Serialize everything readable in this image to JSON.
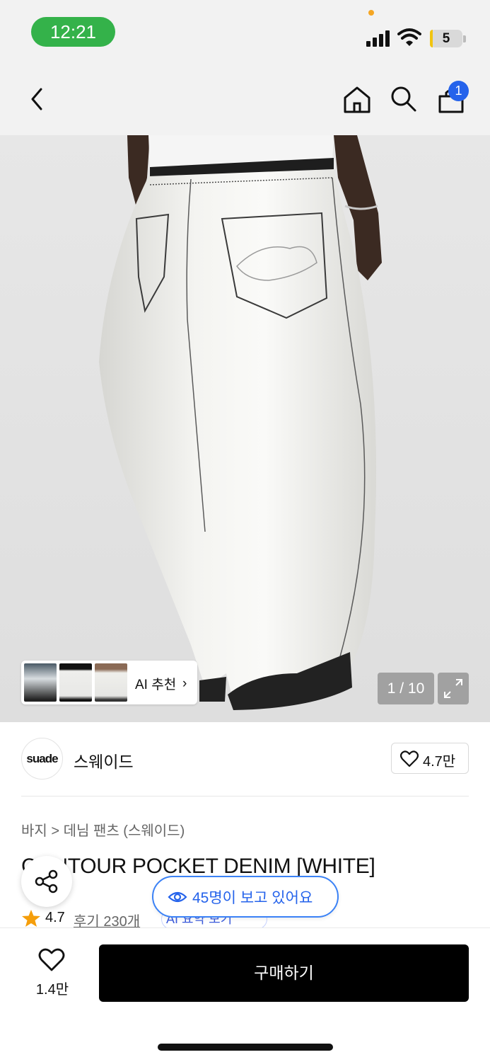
{
  "status_bar": {
    "time": "12:21",
    "battery": "5",
    "icons": [
      "signal-icon",
      "wifi-icon",
      "battery-icon"
    ],
    "time_pill_color": "#34b24a",
    "battery_level_percent": 5
  },
  "nav": {
    "icons": [
      "back-icon",
      "home-icon",
      "search-icon",
      "cart-icon"
    ],
    "cart_badge": "1",
    "badge_color": "#2563eb"
  },
  "gallery": {
    "ai_recommend_label": "AI 추천",
    "chevron": "›",
    "counter": "1 / 10",
    "thumbnails": [
      "product-thumb-1",
      "product-thumb-2",
      "product-thumb-3"
    ]
  },
  "brand": {
    "logo_text": "suade",
    "name": "스웨이드",
    "like_count": "4.7만"
  },
  "product": {
    "breadcrumb": "바지 > 데님 팬츠 (스웨이드)",
    "title": "CONTOUR POCKET DENIM [WHITE]",
    "viewers": "45명이 보고 있어요",
    "rating": "4.7",
    "reviews": "후기 230개",
    "ai_summary": "AI 요약 보기"
  },
  "bottom_bar": {
    "wish_count": "1.4만",
    "buy_label": "구매하기"
  }
}
